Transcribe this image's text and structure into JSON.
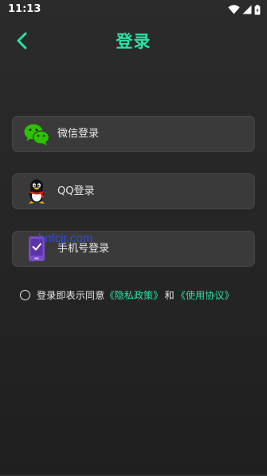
{
  "status_bar": {
    "time": "11:13",
    "icons": [
      "wifi-icon",
      "signal-icon",
      "battery-icon"
    ]
  },
  "header": {
    "back_icon": "chevron-left-icon",
    "title": "登录"
  },
  "login_options": [
    {
      "label": "微信登录",
      "icon": "wechat-icon"
    },
    {
      "label": "QQ登录",
      "icon": "qq-penguin-icon"
    },
    {
      "label": "手机号登录",
      "icon": "phone-icon"
    }
  ],
  "watermark": "hnfcjr.com",
  "agreement": {
    "prefix": "登录即表示同意",
    "privacy_policy": "《隐私政策》",
    "and": "和",
    "user_agreement": "《使用协议》"
  },
  "colors": {
    "accent": "#29e3a2",
    "background": "#262626",
    "card": "#3a3a3a",
    "wechat": "#2dc100",
    "phone_icon": "#7b4cc8",
    "watermark": "#2d50ff"
  }
}
